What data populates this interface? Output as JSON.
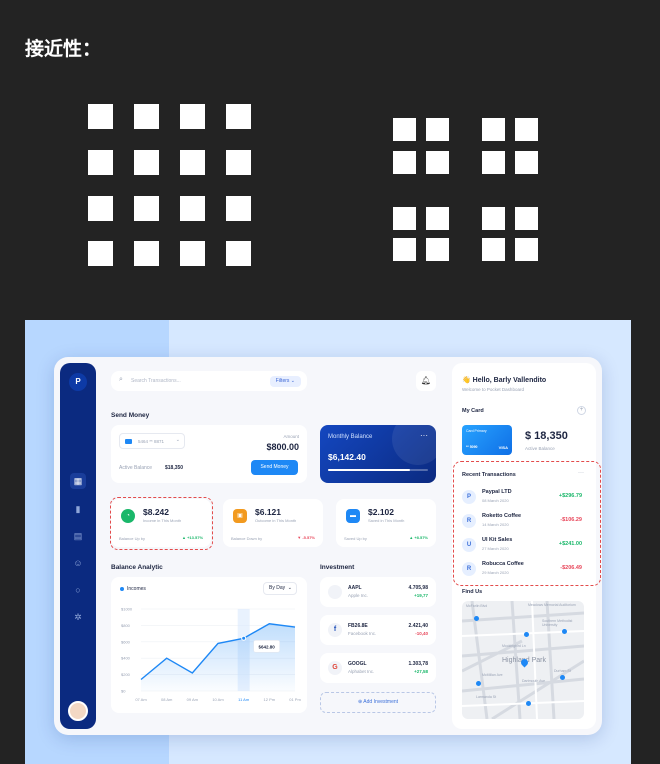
{
  "heading": "接近性：",
  "search": {
    "placeholder": "Search Transactions...",
    "filters": "Filters"
  },
  "send_money": {
    "title": "Send Money",
    "card_number": "5464 ** 8871",
    "amount_label": "Amount",
    "amount": "$800.00",
    "active_balance_label": "Active Balance",
    "active_balance": "$18,350",
    "button": "Send Money"
  },
  "monthly": {
    "title": "Monthly Balance",
    "value": "$6,142.40",
    "progress": 0.82
  },
  "stats": [
    {
      "value": "$8.242",
      "sub": "Income in This Month",
      "foot": "Balance Up by",
      "change": "+13.57%",
      "dir": "up",
      "color": "#1ab76a"
    },
    {
      "value": "$6.121",
      "sub": "Outcome in This Month",
      "foot": "Balance Down by",
      "change": "-5.57%",
      "dir": "down",
      "color": "#f29a1f"
    },
    {
      "value": "$2.102",
      "sub": "Saved in This Month",
      "foot": "Saved Up by",
      "change": "+8.57%",
      "dir": "up",
      "color": "#1e88f5"
    }
  ],
  "analytic": {
    "title": "Balance Analytic",
    "legend": "Incomes",
    "range": "By Day",
    "tooltip": "$642.80",
    "y_ticks": [
      "$1000",
      "$800",
      "$600",
      "$400",
      "$200",
      "$0"
    ],
    "x_ticks": [
      "07 Am",
      "08 Am",
      "09 Am",
      "10 Am",
      "11 Am",
      "12 Pm",
      "01 Pm"
    ]
  },
  "chart_data": {
    "type": "area",
    "title": "Balance Analytic",
    "x": [
      "07 Am",
      "08 Am",
      "09 Am",
      "10 Am",
      "11 Am",
      "12 Pm",
      "01 Pm"
    ],
    "series": [
      {
        "name": "Incomes",
        "values": [
          140,
          400,
          220,
          580,
          643,
          820,
          780
        ]
      }
    ],
    "ylim": [
      0,
      1000
    ],
    "grid": true
  },
  "investment": {
    "title": "Investment",
    "items": [
      {
        "ticker": "AAPL",
        "company": "Apple Inc.",
        "value": "4.705,98",
        "change": "+19,77",
        "icon": "",
        "up": true
      },
      {
        "ticker": "FB26.8E",
        "company": "Facebook Inc.",
        "value": "2.421,40",
        "change": "-10,40",
        "icon": "f",
        "up": false
      },
      {
        "ticker": "GOOGL",
        "company": "Alphabet Inc.",
        "value": "1.303,78",
        "change": "+27,58",
        "icon": "G",
        "up": true
      }
    ],
    "add": "Add Investment"
  },
  "profile": {
    "greeting": "👋 Hello, Barly Vallendito",
    "welcome": "Welcome to Pocket Dashboard",
    "my_card": "My Card",
    "card_label": "Card Primary",
    "card_num": "** 5090",
    "card_brand": "VISA",
    "balance": "$ 18,350",
    "balance_label": "Active Balance"
  },
  "transactions": {
    "title": "Recent Transactions",
    "items": [
      {
        "icon": "P",
        "name": "Paypal LTD",
        "date": "08 March 2020",
        "amount": "+$296.79",
        "up": true
      },
      {
        "icon": "R",
        "name": "Roketto Coffee",
        "date": "14 March 2020",
        "amount": "-$106.29",
        "up": false
      },
      {
        "icon": "U",
        "name": "UI Kit Sales",
        "date": "27 March 2020",
        "amount": "+$241.00",
        "up": true
      },
      {
        "icon": "R",
        "name": "Robucca Coffee",
        "date": "29 March 2020",
        "amount": "-$206.49",
        "up": false
      }
    ]
  },
  "map": {
    "title": "Find Us",
    "labels": [
      "McFarlin Blvd",
      "Meadows Memorial Auditorium",
      "Southern Methodist University",
      "Mockingbird Ln",
      "Highland Park",
      "Durham St",
      "McMillan Ave",
      "Dartmouth Ave",
      "Larmanda St"
    ]
  }
}
